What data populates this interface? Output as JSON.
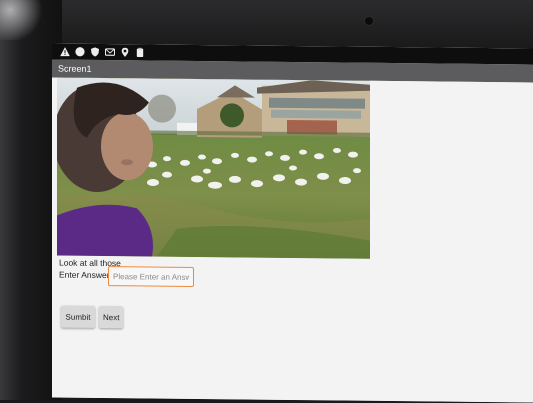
{
  "status_bar": {
    "icons": [
      "warning-icon",
      "circle-icon",
      "shield-icon",
      "mail-icon",
      "location-icon",
      "clipboard-icon"
    ]
  },
  "app": {
    "title": "Screen1"
  },
  "form": {
    "prompt_label": "Look at all those _____",
    "answer_label": "Enter Answer",
    "answer_placeholder": "Please Enter an Answer",
    "answer_value": "",
    "submit_label": "Sumbit",
    "next_label": "Next"
  },
  "colors": {
    "status_bar_bg": "#0e0e0f",
    "action_bar_bg": "#5c5c5e",
    "input_focus_border": "#f08a3a",
    "button_bg": "#d9d9da"
  }
}
